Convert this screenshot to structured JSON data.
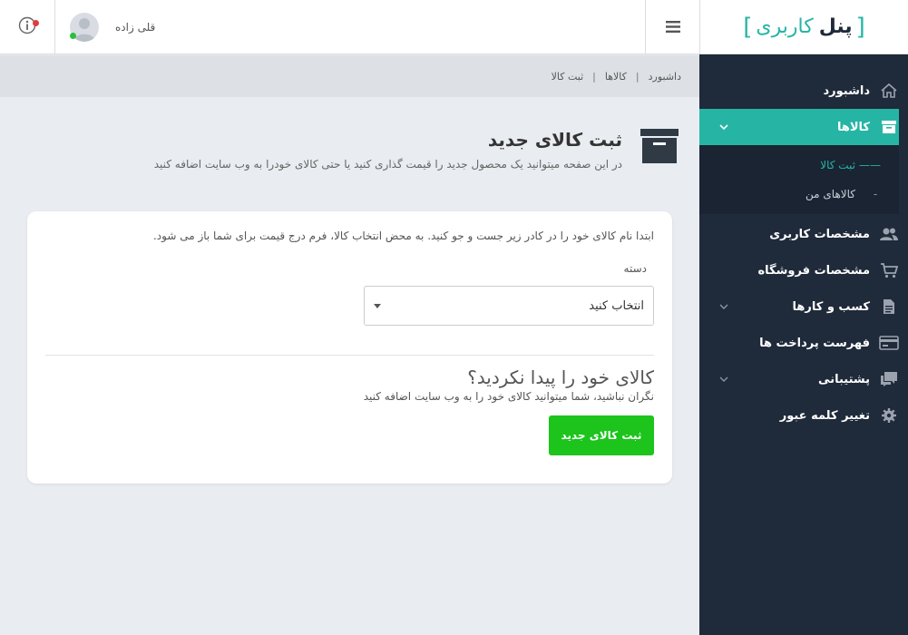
{
  "brand": {
    "bracket_open": "[",
    "part1": "پنل",
    "part2": "کاربری",
    "bracket_close": "]"
  },
  "header": {
    "username": "قلی زاده"
  },
  "breadcrumb": [
    "داشبورد",
    "کالاها",
    "ثبت کالا"
  ],
  "sidebar": {
    "items": [
      {
        "label": "داشبورد",
        "icon": "home-icon"
      },
      {
        "label": "کالاها",
        "icon": "archive-icon",
        "active": true
      },
      {
        "label": "مشخصات کاربری",
        "icon": "users-icon"
      },
      {
        "label": "مشخصات فروشگاه",
        "icon": "cart-icon"
      },
      {
        "label": "کسب و کارها",
        "icon": "document-icon"
      },
      {
        "label": "فهرست پرداخت ها",
        "icon": "credit-card-icon"
      },
      {
        "label": "پشتیبانی",
        "icon": "chat-icon"
      },
      {
        "label": "تغییر کلمه عبور",
        "icon": "gear-icon"
      }
    ],
    "subitems": [
      {
        "label": "ثبت کالا",
        "active": true
      },
      {
        "label": "کالاهای من"
      }
    ]
  },
  "page": {
    "title": "ثبت کالای جدید",
    "subtitle": "در این صفحه میتوانید یک محصول جدید را قیمت گذاری کنید یا حتی کالای خودرا به وب سایت اضافه کنید"
  },
  "card": {
    "intro": "ابتدا نام کالای خود را در کادر زیر جست و جو کنید. به محض انتخاب کالا، فرم درج قیمت برای شما باز می شود.",
    "category_label": "دسته",
    "category_value": "انتخاب کنید",
    "not_found_title": "کالای خود را پیدا نکردید؟",
    "not_found_sub": "نگران نباشید، شما میتوانید کالای خود را به وب سایت اضافه کنید",
    "button_label": "ثبت کالای جدید"
  },
  "colors": {
    "accent": "#26b5a5",
    "sidebar_bg": "#1f2a3a",
    "button_green": "#1cc41c",
    "online": "#27c13c",
    "alert": "#e23b3b"
  }
}
